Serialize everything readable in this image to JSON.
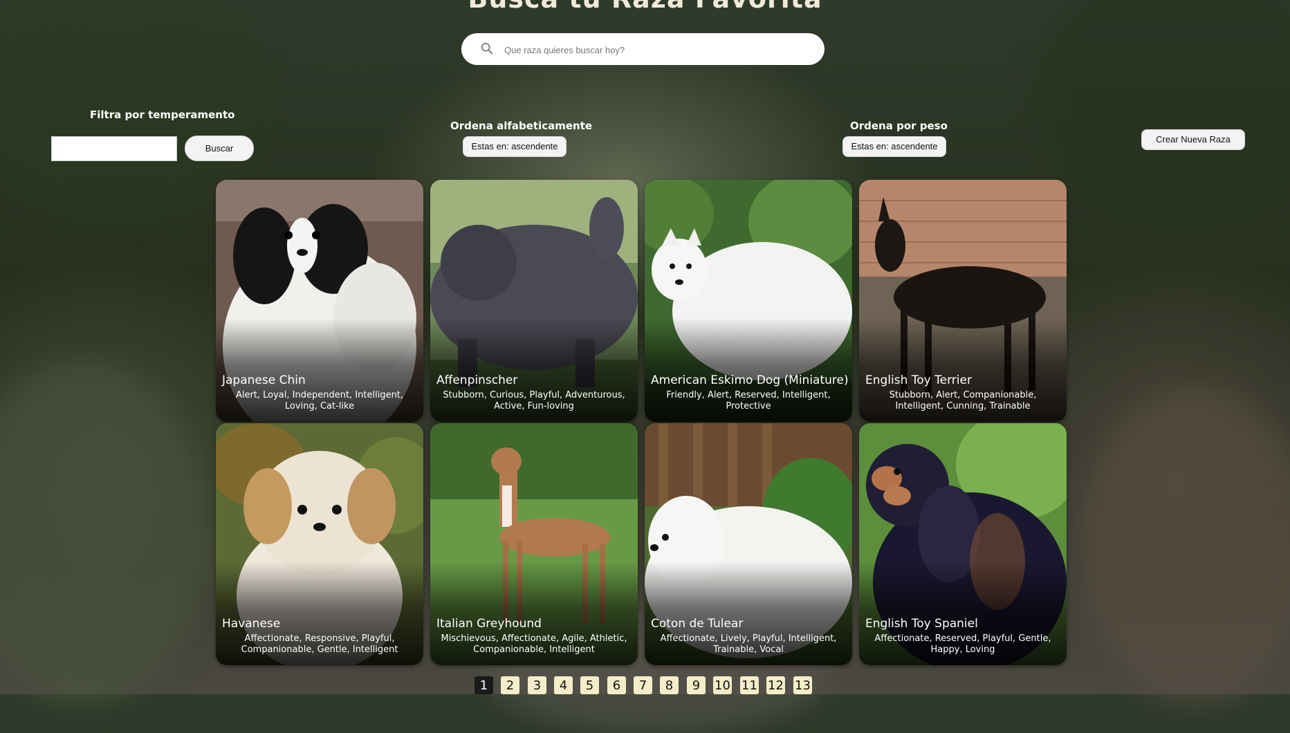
{
  "header": {
    "title": "Busca tu Raza Favorita",
    "search_placeholder": "Que raza quieres buscar hoy?",
    "search_icon": "search-icon"
  },
  "filters": {
    "temperament_label": "Filtra por temperamento",
    "temperament_value": "",
    "search_button": "Buscar",
    "alpha_label": "Ordena alfabeticamente",
    "alpha_button": "Estas en: ascendente",
    "weight_label": "Ordena por peso",
    "weight_button": "Estas en: ascendente",
    "create_button": "Crear Nueva Raza"
  },
  "cards": [
    {
      "name": "Japanese Chin",
      "temperament": "Alert, Loyal, Independent, Intelligent, Loving, Cat-like"
    },
    {
      "name": "Affenpinscher",
      "temperament": "Stubborn, Curious, Playful, Adventurous, Active, Fun-loving"
    },
    {
      "name": "American Eskimo Dog (Miniature)",
      "temperament": "Friendly, Alert, Reserved, Intelligent, Protective"
    },
    {
      "name": "English Toy Terrier",
      "temperament": "Stubborn, Alert, Companionable, Intelligent, Cunning, Trainable"
    },
    {
      "name": "Havanese",
      "temperament": "Affectionate, Responsive, Playful, Companionable, Gentle, Intelligent"
    },
    {
      "name": "Italian Greyhound",
      "temperament": "Mischievous, Affectionate, Agile, Athletic, Companionable, Intelligent"
    },
    {
      "name": "Coton de Tulear",
      "temperament": "Affectionate, Lively, Playful, Intelligent, Trainable, Vocal"
    },
    {
      "name": "English Toy Spaniel",
      "temperament": "Affectionate, Reserved, Playful, Gentle, Happy, Loving"
    }
  ],
  "pagination": {
    "pages": [
      "1",
      "2",
      "3",
      "4",
      "5",
      "6",
      "7",
      "8",
      "9",
      "10",
      "11",
      "12",
      "13"
    ],
    "current": "1"
  },
  "colors": {
    "title": "#f1ead8",
    "page_button": "#f5edc8",
    "page_active": "#1a1a1a"
  }
}
